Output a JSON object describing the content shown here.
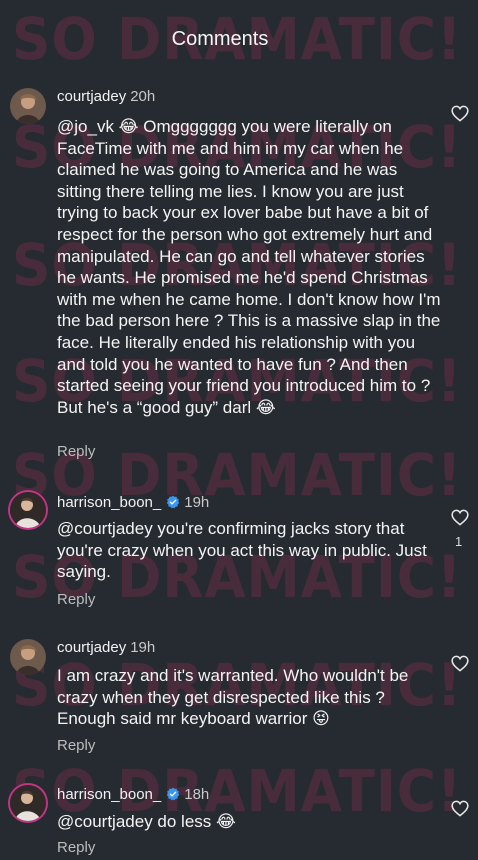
{
  "header": {
    "title": "Comments"
  },
  "watermark": {
    "text": "SO DRAMATIC!",
    "color": "#c2345f"
  },
  "comments": [
    {
      "username": "courtjadey",
      "time": "20h",
      "verified": false,
      "text": "@jo_vk 😂 Omggggggg you were literally on FaceTime with me and him in my car when he claimed he was going to America and he was sitting there telling me lies. I know you are just trying to back your ex lover babe but have a bit of respect for the person who got extremely hurt and manipulated. He can go and tell whatever stories he wants. He promised me he'd spend Christmas with me when he came home. I don't know how I'm the bad person here ? This is a massive slap in the face. He literally ended his relationship with you and told you he wanted to have fun ? And then started seeing your friend you introduced him to ?  But he's a “good guy” darl 😂",
      "reply_label": "Reply",
      "like_count": ""
    },
    {
      "username": "harrison_boon_",
      "time": "19h",
      "verified": true,
      "text": "@courtjadey you're confirming jacks story that you're crazy when you act this way in public. Just saying.",
      "reply_label": "Reply",
      "like_count": "1"
    },
    {
      "username": "courtjadey",
      "time": "19h",
      "verified": false,
      "text": "I am crazy and it's warranted. Who wouldn't be crazy when they get disrespected like this ? Enough said mr keyboard warrior 😝",
      "reply_label": "Reply",
      "like_count": ""
    },
    {
      "username": "harrison_boon_",
      "time": "18h",
      "verified": true,
      "text": "@courtjadey do less 😂",
      "reply_label": "Reply",
      "like_count": ""
    }
  ],
  "icons": {
    "like": "heart-outline-icon",
    "verified": "verified-badge-icon",
    "verified_color": "#3897f0"
  }
}
